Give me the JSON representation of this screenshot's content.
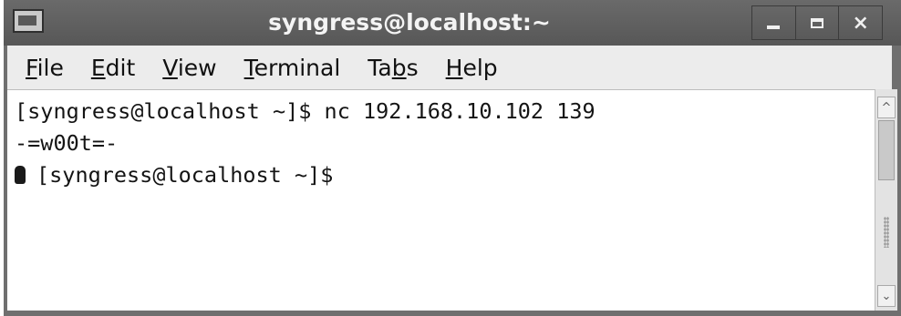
{
  "window": {
    "title": "syngress@localhost:~",
    "app_icon": "terminal-icon",
    "buttons": {
      "minimize": "minimize-icon",
      "maximize": "maximize-icon",
      "close_label": "×"
    }
  },
  "menu": [
    {
      "prefix": "",
      "underlined": "F",
      "suffix": "ile"
    },
    {
      "prefix": "",
      "underlined": "E",
      "suffix": "dit"
    },
    {
      "prefix": "",
      "underlined": "V",
      "suffix": "iew"
    },
    {
      "prefix": "",
      "underlined": "T",
      "suffix": "erminal"
    },
    {
      "prefix": "Ta",
      "underlined": "b",
      "suffix": "s"
    },
    {
      "prefix": "",
      "underlined": "H",
      "suffix": "elp"
    }
  ],
  "terminal": {
    "lines": [
      "[syngress@localhost ~]$ nc 192.168.10.102 139",
      "-=w00t=-",
      "[syngress@localhost ~]$"
    ],
    "unknown_glyph": "unknown-character-icon"
  },
  "scrollbar": {
    "up_arrow": "^",
    "down_arrow": "⌄"
  },
  "colors": {
    "titlebar": "#5f5f5f",
    "menubar": "#ececec",
    "terminal_bg": "#ffffff",
    "text": "#141414"
  }
}
